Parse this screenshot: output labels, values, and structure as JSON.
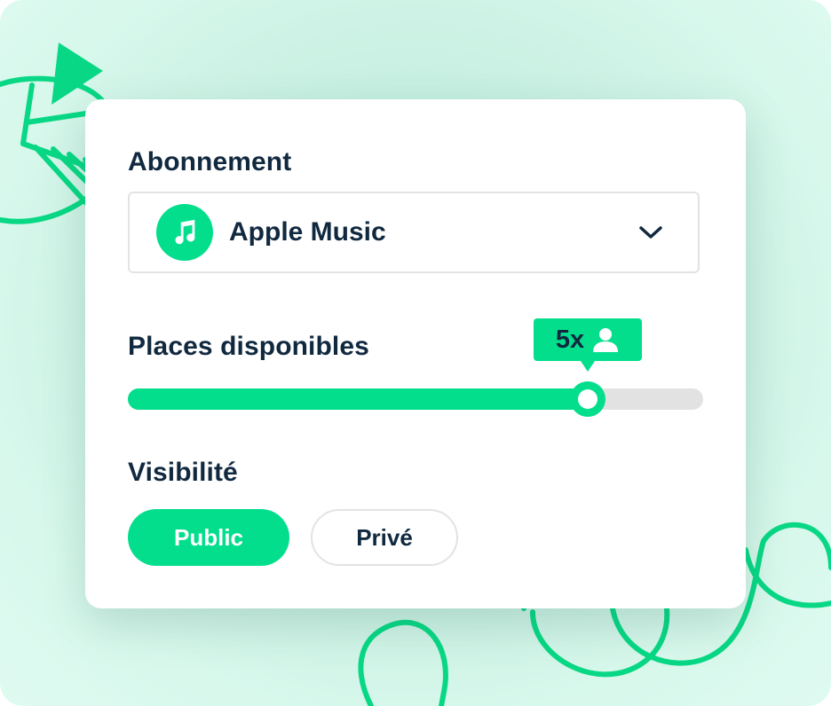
{
  "subscription": {
    "label": "Abonnement",
    "selected": "Apple Music",
    "icon": "music-note-icon",
    "dropdown_icon": "chevron-down-icon"
  },
  "seats": {
    "label": "Places disponibles",
    "badge_text": "5x",
    "badge_icon": "person-icon",
    "slider_fraction": 0.8
  },
  "visibility": {
    "label": "Visibilité",
    "options": [
      "Public",
      "Privé"
    ],
    "selected": "Public"
  },
  "colors": {
    "accent": "#03de8c",
    "text": "#11293f",
    "track": "#e2e2e2",
    "background": "#d8f8ec"
  }
}
